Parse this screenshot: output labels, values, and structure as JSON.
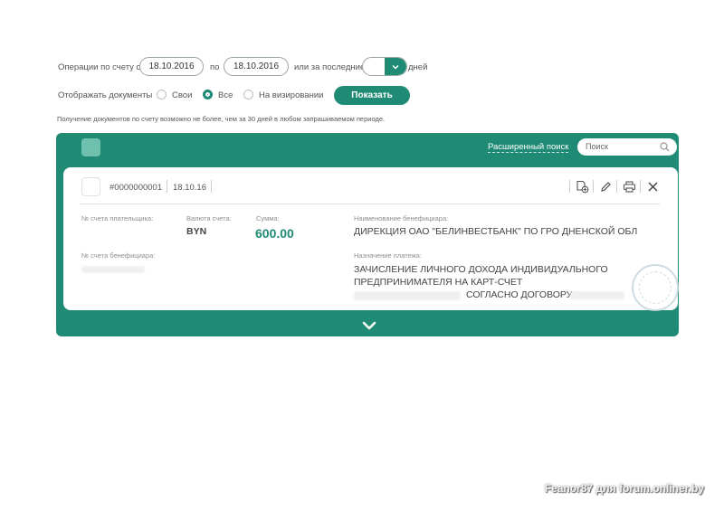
{
  "filter": {
    "period_label": "Операции по счету с",
    "date_from": "18.10.2016",
    "to_label": "по",
    "date_to": "18.10.2016",
    "last_label": "или за последние",
    "days_value": "",
    "days_label": "дней",
    "show_docs_label": "Отображать документы",
    "radio_own": "Свои",
    "radio_all": "Все",
    "radio_approval": "На визировании",
    "selected_radio": "all",
    "show_button": "Показать",
    "note": "Получение документов по счету возможно не более, чем за 30 дней в любом запрашиваемом периоде."
  },
  "panel": {
    "advanced_search": "Расширенный поиск",
    "search_placeholder": "Поиск"
  },
  "document": {
    "number": "#0000000001",
    "time": "18.10.16",
    "payer_account_label": "№ счета плательщика:",
    "currency_label": "Валюта счета:",
    "currency_value": "BYN",
    "amount_label": "Сумма:",
    "amount_value": "600.00",
    "beneficiary_name_label": "Наименование бенефициара:",
    "beneficiary_name_value": "ДИРЕКЦИЯ ОАО \"БЕЛИНВЕСТБАНК\" ПО ГРО ДНЕНСКОЙ ОБЛ",
    "beneficiary_account_label": "№ счета бенефициара:",
    "purpose_label": "Назначение платежа:",
    "purpose_line1": "ЗАЧИСЛЕНИЕ ЛИЧНОГО ДОХОДА ИНДИВИДУАЛЬНОГО",
    "purpose_line2": "ПРЕДПРИНИМАТЕЛЯ НА КАРТ-СЧЕТ",
    "purpose_line3": "СОГЛАСНО ДОГОВОРУ"
  },
  "watermark": "Feanor87 для forum.onliner.by",
  "colors": {
    "accent": "#1f8b74",
    "panel_square": "#6fc1ad"
  },
  "icons": [
    "chevron-down-icon",
    "search-icon",
    "copy-document-icon",
    "pencil-icon",
    "printer-icon",
    "close-icon",
    "expand-chevron-icon"
  ]
}
